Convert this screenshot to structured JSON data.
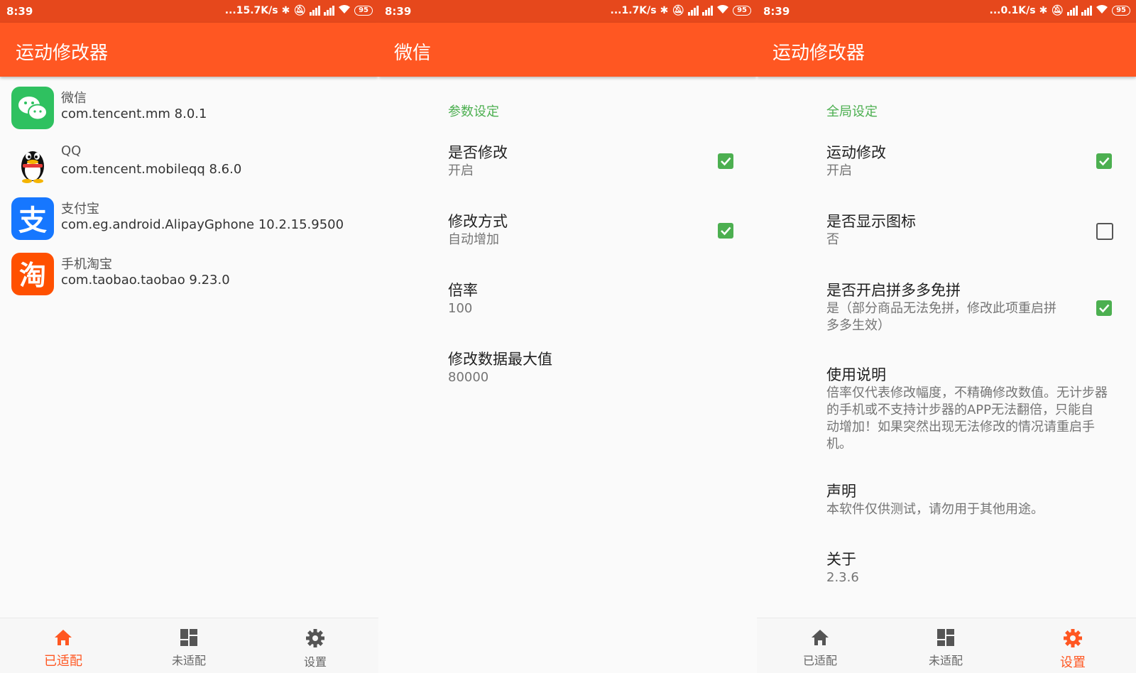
{
  "status": {
    "time": "8:39",
    "screen1_speed": "...15.7K/s",
    "screen2_speed": "...1.7K/s",
    "screen3_speed": "...0.1K/s",
    "battery": "95"
  },
  "colors": {
    "status_bar": "#e6481c",
    "app_bar": "#ff5722",
    "accent_green": "#4caf50",
    "active_tab": "#ff5722"
  },
  "screen1": {
    "title": "运动修改器",
    "apps": [
      {
        "name": "微信",
        "package": "com.tencent.mm 8.0.1",
        "icon": "wechat-icon"
      },
      {
        "name": "QQ",
        "package": "com.tencent.mobileqq 8.6.0",
        "icon": "qq-icon"
      },
      {
        "name": "支付宝",
        "package": "com.eg.android.AlipayGphone 10.2.15.9500",
        "icon": "alipay-icon"
      },
      {
        "name": "手机淘宝",
        "package": "com.taobao.taobao 9.23.0",
        "icon": "taobao-icon"
      }
    ]
  },
  "screen2": {
    "title": "微信",
    "category": "参数设定",
    "prefs": [
      {
        "title": "是否修改",
        "summary": "开启",
        "checked": true
      },
      {
        "title": "修改方式",
        "summary": "自动增加",
        "checked": true
      },
      {
        "title": "倍率",
        "summary": "100"
      },
      {
        "title": "修改数据最大值",
        "summary": "80000"
      }
    ]
  },
  "screen3": {
    "title": "运动修改器",
    "category": "全局设定",
    "prefs": [
      {
        "title": "运动修改",
        "summary": "开启",
        "checked": true
      },
      {
        "title": "是否显示图标",
        "summary": "否",
        "checked": false
      },
      {
        "title": "是否开启拼多多免拼",
        "summary_line1": "是（部分商品无法免拼，修改此项重启拼",
        "summary_line2": "多多生效）",
        "checked": true
      },
      {
        "title": "使用说明",
        "summary_line1": "倍率仅代表修改幅度，不精确修改数值。无计步器",
        "summary_line2": "的手机或不支持计步器的APP无法翻倍，只能自",
        "summary_line3": "动增加！如果突然出现无法修改的情况请重启手",
        "summary_line4": "机。"
      },
      {
        "title": "声明",
        "summary": "本软件仅供测试，请勿用于其他用途。"
      },
      {
        "title": "关于",
        "summary": "2.3.6"
      }
    ]
  },
  "nav": {
    "adapted": "已适配",
    "unadapted": "未适配",
    "settings": "设置"
  }
}
